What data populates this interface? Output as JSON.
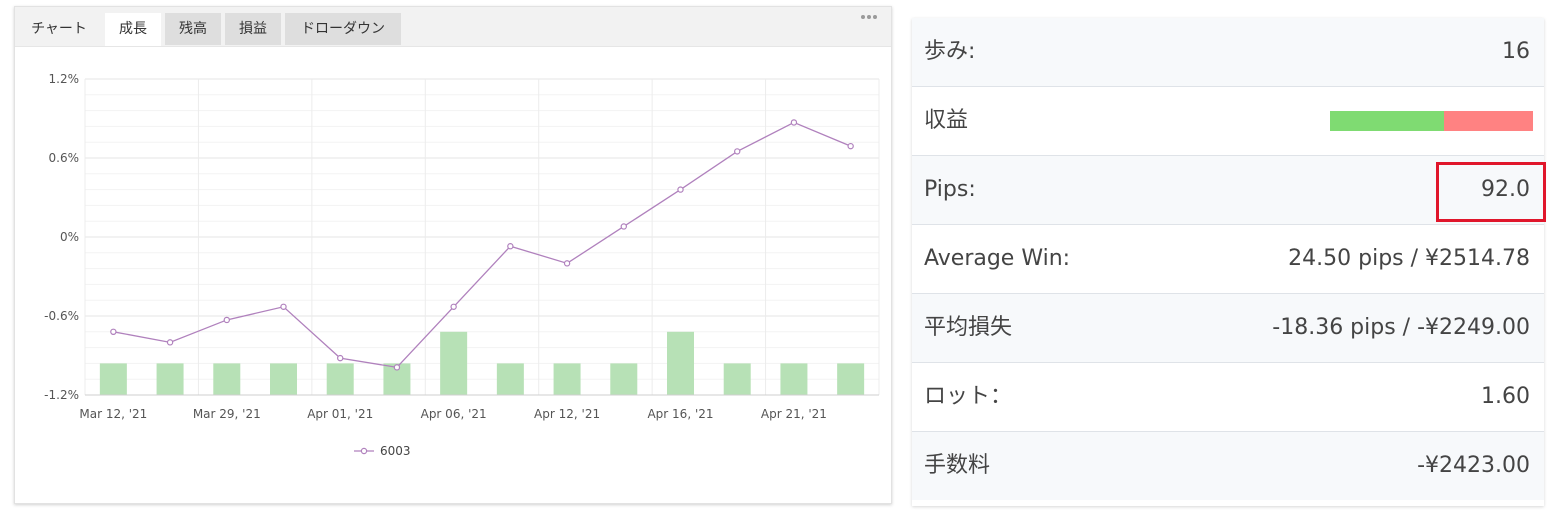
{
  "tabs": [
    {
      "label": "チャート"
    },
    {
      "label": "成長"
    },
    {
      "label": "残高"
    },
    {
      "label": "損益"
    },
    {
      "label": "ドローダウン"
    }
  ],
  "active_tab": "成長",
  "menu_icon": "more-dots-icon",
  "chart_data": {
    "type": "bar+line",
    "categories": [
      "Mar 12, '21",
      "",
      "Mar 29, '21",
      "",
      "Apr 01, '21",
      "",
      "Apr 06, '21",
      "",
      "Apr 12, '21",
      "",
      "Apr 16, '21",
      "",
      "Apr 21, '21",
      ""
    ],
    "x_tick_labels": [
      "Mar 12, '21",
      "Mar 29, '21",
      "Apr 01, '21",
      "Apr 06, '21",
      "Apr 12, '21",
      "Apr 16, '21",
      "Apr 21, '21"
    ],
    "y_tick_labels": [
      "1.2%",
      "0.6%",
      "0%",
      "-0.6%",
      "-1.2%"
    ],
    "ylim": [
      -1.2,
      1.2
    ],
    "grid": true,
    "legend_position": "bottom",
    "series": [
      {
        "name": "6003",
        "type": "line",
        "color": "#b081bd",
        "values": [
          -0.72,
          -0.8,
          -0.63,
          -0.53,
          -0.92,
          -0.99,
          -0.53,
          -0.07,
          -0.2,
          0.08,
          0.36,
          0.65,
          0.87,
          0.69
        ]
      },
      {
        "type": "bar",
        "color": "#b7e1b6",
        "values": [
          -0.96,
          -0.96,
          -0.96,
          -0.96,
          -0.96,
          -0.96,
          -0.72,
          -0.96,
          -0.96,
          -0.96,
          -0.72,
          -0.96,
          -0.96,
          -0.96
        ]
      }
    ]
  },
  "stats": [
    {
      "label": "歩み:",
      "value": "16"
    },
    {
      "label": "収益",
      "value": "",
      "win_ratio": 0.56,
      "win_color": "#7fdb72",
      "loss_color": "#ff8282"
    },
    {
      "label": "Pips:",
      "value": "92.0"
    },
    {
      "label": "Average Win:",
      "value": "24.50 pips / ¥2514.78"
    },
    {
      "label": "平均損失",
      "value": "-18.36 pips / -¥2249.00"
    },
    {
      "label": "ロット：",
      "value": "1.60"
    },
    {
      "label": "手数料",
      "value": "-¥2423.00"
    }
  ],
  "highlight_color": "#e0162b"
}
